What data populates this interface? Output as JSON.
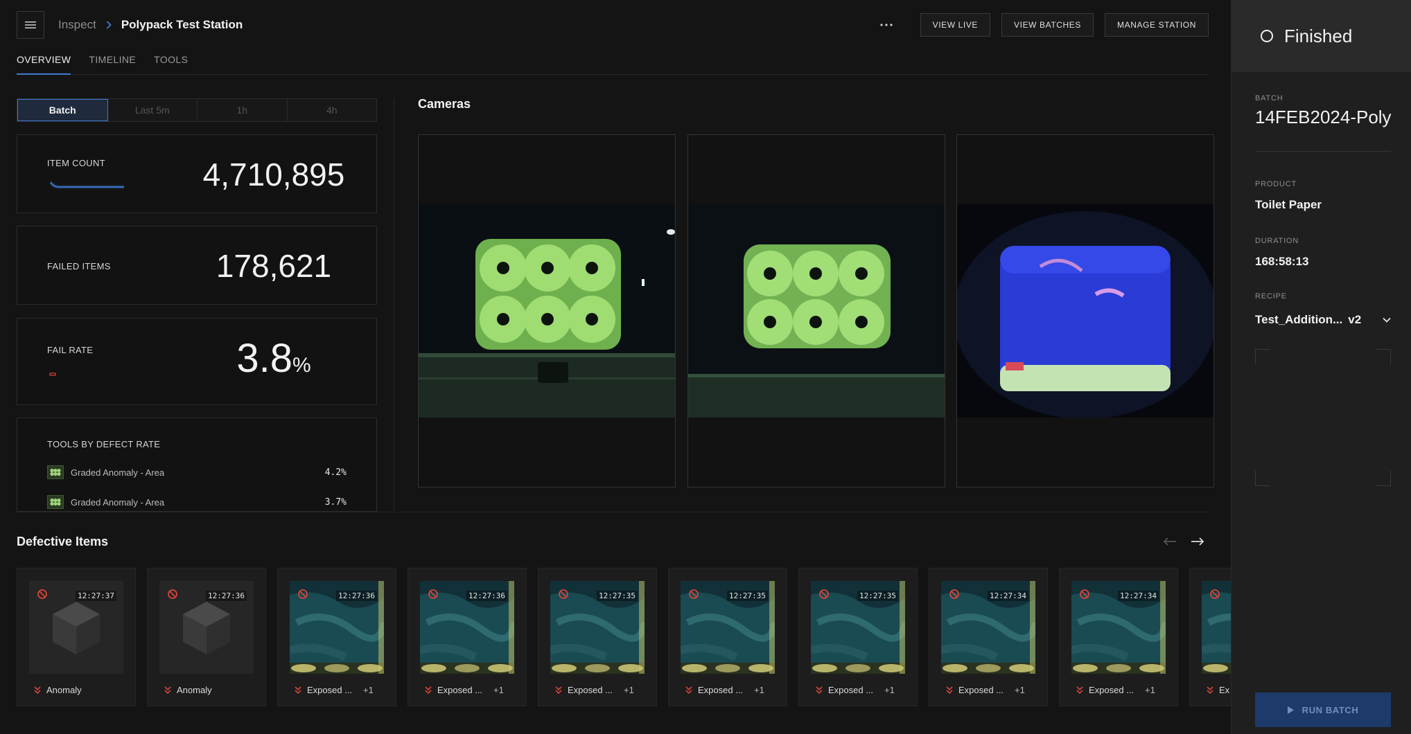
{
  "breadcrumb": {
    "root": "Inspect",
    "current": "Polypack Test Station"
  },
  "topbar": {
    "more_label": "···",
    "view_live": "VIEW LIVE",
    "view_batches": "VIEW BATCHES",
    "manage_station": "MANAGE STATION"
  },
  "tabs": [
    {
      "label": "OVERVIEW",
      "active": true
    },
    {
      "label": "TIMELINE",
      "active": false
    },
    {
      "label": "TOOLS",
      "active": false
    }
  ],
  "time_range": {
    "options": [
      "Batch",
      "Last 5m",
      "1h",
      "4h"
    ],
    "selected": "Batch"
  },
  "metrics": {
    "item_count": {
      "label": "ITEM COUNT",
      "value": "4,710,895"
    },
    "failed_items": {
      "label": "FAILED ITEMS",
      "value": "178,621"
    },
    "fail_rate": {
      "label": "FAIL RATE",
      "value": "3.8",
      "unit": "%"
    }
  },
  "tools_by_defect": {
    "title": "TOOLS BY DEFECT RATE",
    "items": [
      {
        "name": "Graded Anomaly - Area",
        "rate": "4.2%"
      },
      {
        "name": "Graded Anomaly - Area",
        "rate": "3.7%"
      }
    ]
  },
  "cameras": {
    "title": "Cameras"
  },
  "defective_items": {
    "title": "Defective Items",
    "items": [
      {
        "time": "12:27:37",
        "label": "Anomaly",
        "extra": "",
        "thumb": "cube"
      },
      {
        "time": "12:27:36",
        "label": "Anomaly",
        "extra": "",
        "thumb": "cube"
      },
      {
        "time": "12:27:36",
        "label": "Exposed ...",
        "extra": "+1",
        "thumb": "photo"
      },
      {
        "time": "12:27:36",
        "label": "Exposed ...",
        "extra": "+1",
        "thumb": "photo"
      },
      {
        "time": "12:27:35",
        "label": "Exposed ...",
        "extra": "+1",
        "thumb": "photo"
      },
      {
        "time": "12:27:35",
        "label": "Exposed ...",
        "extra": "+1",
        "thumb": "photo"
      },
      {
        "time": "12:27:35",
        "label": "Exposed ...",
        "extra": "+1",
        "thumb": "photo"
      },
      {
        "time": "12:27:34",
        "label": "Exposed ...",
        "extra": "+1",
        "thumb": "photo"
      },
      {
        "time": "12:27:34",
        "label": "Exposed ...",
        "extra": "+1",
        "thumb": "photo"
      },
      {
        "time": "",
        "label": "Ex",
        "extra": "",
        "thumb": "photo"
      }
    ]
  },
  "side_panel": {
    "status": "Finished",
    "batch_label": "BATCH",
    "batch_value": "14FEB2024-Poly",
    "product_label": "PRODUCT",
    "product_value": "Toilet Paper",
    "duration_label": "DURATION",
    "duration_value": "168:58:13",
    "recipe_label": "RECIPE",
    "recipe_value": "Test_Addition...",
    "recipe_version": "v2",
    "run_batch": "RUN BATCH"
  },
  "colors": {
    "accent": "#3f7bd4",
    "background": "#141414",
    "panel": "#1f1f1f",
    "fail_red": "#d9443a",
    "run_button": "#1d3a6b"
  }
}
